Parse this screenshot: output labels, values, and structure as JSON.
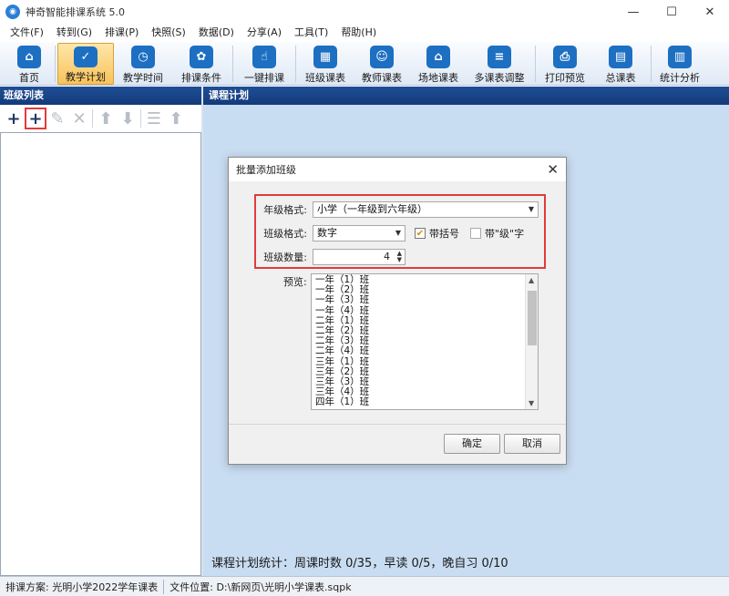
{
  "window": {
    "title": "神奇智能排课系统 5.0",
    "icon": "app-logo-icon"
  },
  "menu": [
    {
      "label": "文件(F)"
    },
    {
      "label": "转到(G)"
    },
    {
      "label": "排课(P)"
    },
    {
      "label": "快照(S)"
    },
    {
      "label": "数据(D)"
    },
    {
      "label": "分享(A)"
    },
    {
      "label": "工具(T)"
    },
    {
      "label": "帮助(H)"
    }
  ],
  "toolbar": [
    {
      "label": "首页",
      "icon": "home-icon",
      "glyph": "⌂"
    },
    {
      "label": "教学计划",
      "icon": "clipboard-icon",
      "glyph": "✓",
      "active": true
    },
    {
      "label": "教学时间",
      "icon": "clock-icon",
      "glyph": "◷"
    },
    {
      "label": "排课条件",
      "icon": "conditions-icon",
      "glyph": "✿"
    },
    {
      "label": "一键排课",
      "icon": "touch-icon",
      "glyph": "☝"
    },
    {
      "label": "班级课表",
      "icon": "class-schedule-icon",
      "glyph": "▦"
    },
    {
      "label": "教师课表",
      "icon": "teacher-schedule-icon",
      "glyph": "☺"
    },
    {
      "label": "场地课表",
      "icon": "venue-schedule-icon",
      "glyph": "⌂"
    },
    {
      "label": "多课表调整",
      "icon": "multi-adjust-icon",
      "glyph": "≡"
    },
    {
      "label": "打印预览",
      "icon": "printer-icon",
      "glyph": "⎙"
    },
    {
      "label": "总课表",
      "icon": "master-schedule-icon",
      "glyph": "▤"
    },
    {
      "label": "统计分析",
      "icon": "chart-icon",
      "glyph": "▥"
    }
  ],
  "left_panel": {
    "title": "班级列表"
  },
  "right_panel": {
    "title": "课程计划",
    "stats": "课程计划统计：周课时数 0/35，早读 0/5，晚自习 0/10"
  },
  "dialog": {
    "title": "批量添加班级",
    "grade_format_label": "年级格式:",
    "grade_format_value": "小学（一年级到六年级）",
    "class_format_label": "班级格式:",
    "class_format_value": "数字",
    "with_brackets_label": "带括号",
    "with_brackets_checked": true,
    "with_grade_char_label": "带\"级\"字",
    "with_grade_char_checked": false,
    "class_count_label": "班级数量:",
    "class_count_value": "4",
    "preview_label": "预览:",
    "preview_items": [
      "一年（1）班",
      "一年（2）班",
      "一年（3）班",
      "一年（4）班",
      "二年（1）班",
      "二年（2）班",
      "二年（3）班",
      "二年（4）班",
      "三年（1）班",
      "三年（2）班",
      "三年（3）班",
      "三年（4）班",
      "四年（1）班"
    ],
    "ok_label": "确定",
    "cancel_label": "取消"
  },
  "status": {
    "scheme_label": "排课方案:",
    "scheme_value": "光明小学2022学年课表",
    "file_label": "文件位置:",
    "file_value": "D:\\新网页\\光明小学课表.sqpk"
  },
  "colors": {
    "panel_header": "#1f4e96",
    "workspace": "#c9ddf2",
    "highlight_border": "#e23b3b",
    "active_tool": "#f7c35a"
  }
}
